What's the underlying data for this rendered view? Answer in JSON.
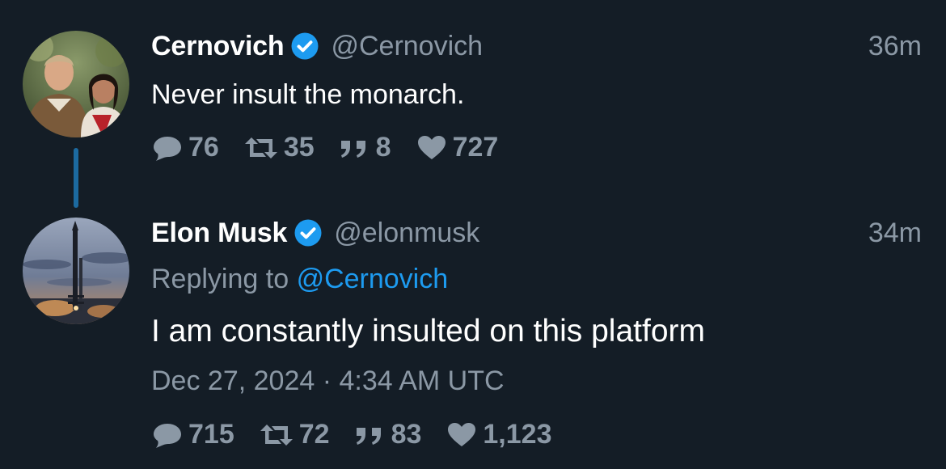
{
  "tweets": [
    {
      "display_name": "Cernovich",
      "handle": "@Cernovich",
      "time": "36m",
      "text": "Never insult the monarch.",
      "avatar_icon": "profile-photo-couple",
      "counts": {
        "replies": "76",
        "retweets": "35",
        "quotes": "8",
        "likes": "727"
      }
    },
    {
      "display_name": "Elon Musk",
      "handle": "@elonmusk",
      "time": "34m",
      "reply_prefix": "Replying to",
      "reply_mention": "@Cernovich",
      "text": "I am constantly insulted on this platform",
      "timestamp": "Dec 27, 2024 · 4:34 AM UTC",
      "avatar_icon": "profile-photo-rocket",
      "counts": {
        "replies": "715",
        "retweets": "72",
        "quotes": "83",
        "likes": "1,123"
      }
    }
  ],
  "colors": {
    "background": "#141d26",
    "muted": "#8b98a5",
    "accent": "#1d9bf0",
    "thread_line": "#1c6aa0"
  },
  "icons": {
    "reply": "reply-bubble-icon",
    "retweet": "retweet-icon",
    "quote": "quote-icon",
    "like": "heart-icon",
    "verified": "verified-badge-icon"
  }
}
